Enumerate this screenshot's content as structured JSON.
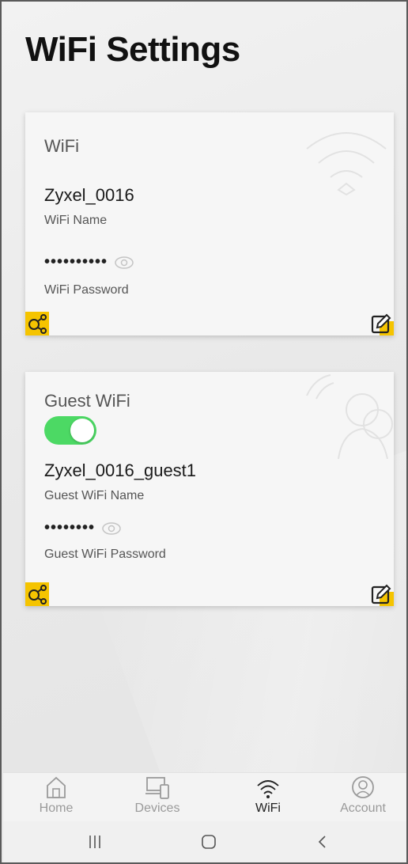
{
  "page": {
    "title": "WiFi Settings"
  },
  "wifi_card": {
    "title": "WiFi",
    "network_name": "Zyxel_0016",
    "network_name_label": "WiFi Name",
    "password_mask": "••••••••••",
    "password_label": "WiFi Password"
  },
  "guest_card": {
    "title": "Guest WiFi",
    "enabled": true,
    "network_name": "Zyxel_0016_guest1",
    "network_name_label": "Guest WiFi Name",
    "password_mask": "••••••••",
    "password_label": "Guest WiFi Password"
  },
  "tabs": [
    {
      "label": "Home",
      "icon": "home-icon",
      "active": false
    },
    {
      "label": "Devices",
      "icon": "devices-icon",
      "active": false
    },
    {
      "label": "WiFi",
      "icon": "wifi-icon",
      "active": true
    },
    {
      "label": "Account",
      "icon": "account-icon",
      "active": false
    }
  ],
  "colors": {
    "accent_yellow": "#f5c400",
    "toggle_on": "#4cd964",
    "text_primary": "#1a1a1a",
    "text_secondary": "#555555",
    "tab_inactive": "#9a9a9a"
  }
}
